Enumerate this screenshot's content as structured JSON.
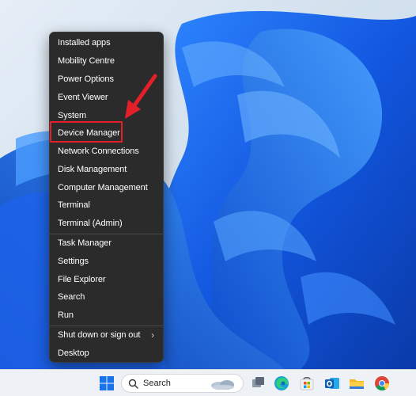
{
  "context_menu": {
    "items": [
      {
        "label": "Installed apps"
      },
      {
        "label": "Mobility Centre"
      },
      {
        "label": "Power Options"
      },
      {
        "label": "Event Viewer"
      },
      {
        "label": "System"
      },
      {
        "label": "Device Manager",
        "highlighted": true
      },
      {
        "label": "Network Connections"
      },
      {
        "label": "Disk Management"
      },
      {
        "label": "Computer Management"
      },
      {
        "label": "Terminal"
      },
      {
        "label": "Terminal (Admin)"
      },
      {
        "label": "Task Manager"
      },
      {
        "label": "Settings"
      },
      {
        "label": "File Explorer"
      },
      {
        "label": "Search"
      },
      {
        "label": "Run"
      },
      {
        "label": "Shut down or sign out",
        "submenu": true
      },
      {
        "label": "Desktop"
      }
    ]
  },
  "annotation": {
    "color": "#e3202a"
  },
  "taskbar": {
    "search_label": "Search",
    "icons": [
      "windows-start-icon",
      "search-icon",
      "weather-widget-icon",
      "task-view-icon",
      "edge-icon",
      "store-icon",
      "outlook-icon",
      "file-explorer-icon",
      "chrome-icon"
    ]
  },
  "colors": {
    "menu_background": "#2b2b2b",
    "taskbar_background": "#eef1f6",
    "wallpaper_blue": "#1a5ee8"
  }
}
